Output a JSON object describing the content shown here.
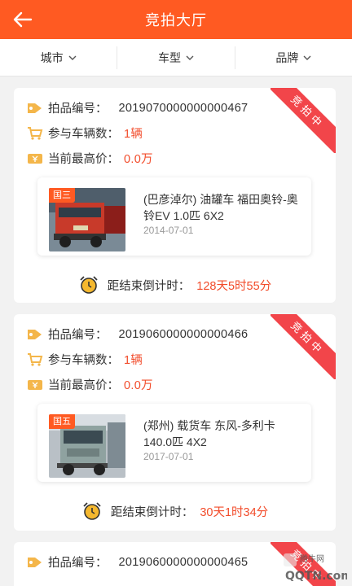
{
  "header": {
    "title": "竞拍大厅",
    "back_icon": "arrow-left-icon"
  },
  "filters": [
    {
      "label": "城市"
    },
    {
      "label": "车型"
    },
    {
      "label": "品牌"
    }
  ],
  "colors": {
    "brand": "#ff5a22",
    "accent_red": "#f24c2b",
    "ribbon": "#f2454a"
  },
  "lots": [
    {
      "ribbon": "竞拍中",
      "lot_label": "拍品编号：",
      "lot_no": "2019070000000000467",
      "count_label": "参与车辆数：",
      "count": "1辆",
      "price_label": "当前最高价：",
      "price": "0.0万",
      "vehicle": {
        "badge": "国三",
        "desc": "(巴彦淖尔) 油罐车 福田奥铃-奥铃EV 1.0匹 6X2",
        "date": "2014-07-01"
      },
      "countdown_label": "距结束倒计时：",
      "countdown": "128天5时55分"
    },
    {
      "ribbon": "竞拍中",
      "lot_label": "拍品编号：",
      "lot_no": "2019060000000000466",
      "count_label": "参与车辆数：",
      "count": "1辆",
      "price_label": "当前最高价：",
      "price": "0.0万",
      "vehicle": {
        "badge": "国五",
        "desc": "(郑州) 载货车 东风-多利卡 140.0匹 4X2",
        "date": "2017-07-01"
      },
      "countdown_label": "距结束倒计时：",
      "countdown": "30天1时34分"
    },
    {
      "ribbon": "竞拍中",
      "lot_label": "拍品编号：",
      "lot_no": "2019060000000000465"
    }
  ],
  "watermark": {
    "top": "腾牛网",
    "bottom": "QQTN.com"
  }
}
